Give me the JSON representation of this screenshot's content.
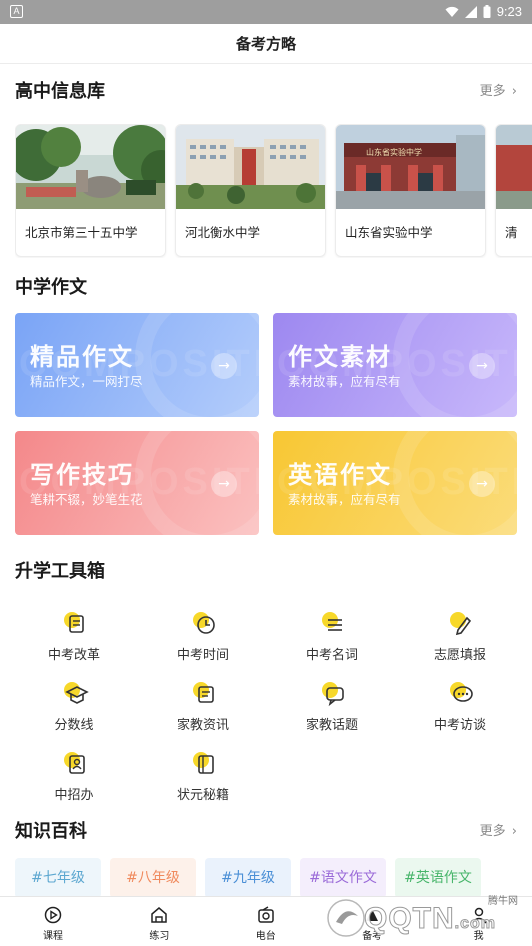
{
  "status_bar": {
    "time": "9:23"
  },
  "header": {
    "title": "备考方略"
  },
  "schools": {
    "title": "高中信息库",
    "more": "更多",
    "items": [
      {
        "name": "北京市第三十五中学"
      },
      {
        "name": "河北衡水中学"
      },
      {
        "name": "山东省实验中学",
        "sign_text": "山东省实验中学"
      },
      {
        "name": "清"
      }
    ]
  },
  "essays": {
    "title": "中学作文",
    "cards": [
      {
        "title": "精品作文",
        "subtitle": "精品作文，一网打尽",
        "bg_word": "COMPOSITION",
        "color_from": "#7aa4f6",
        "color_to": "#b4cdfb"
      },
      {
        "title": "作文素材",
        "subtitle": "素材故事，应有尽有",
        "bg_word": "COMPOSITION",
        "color_from": "#9d88f0",
        "color_to": "#c8b8fb"
      },
      {
        "title": "写作技巧",
        "subtitle": "笔耕不辍，妙笔生花",
        "bg_word": "COMPOSITION",
        "color_from": "#f4888a",
        "color_to": "#fbc1c0"
      },
      {
        "title": "英语作文",
        "subtitle": "素材故事，应有尽有",
        "bg_word": "COMPOSITION",
        "color_from": "#f8c733",
        "color_to": "#fbdc7a"
      }
    ]
  },
  "tools": {
    "title": "升学工具箱",
    "items": [
      {
        "label": "中考改革",
        "icon": "reform-doc-icon"
      },
      {
        "label": "中考时间",
        "icon": "clock-icon"
      },
      {
        "label": "中考名词",
        "icon": "list-icon"
      },
      {
        "label": "志愿填报",
        "icon": "pencil-icon"
      },
      {
        "label": "分数线",
        "icon": "graduation-cap-icon"
      },
      {
        "label": "家教资讯",
        "icon": "scroll-icon"
      },
      {
        "label": "家教话题",
        "icon": "chat-bubble-icon"
      },
      {
        "label": "中考访谈",
        "icon": "dialog-icon"
      },
      {
        "label": "中招办",
        "icon": "id-badge-icon"
      },
      {
        "label": "状元秘籍",
        "icon": "book-icon"
      }
    ]
  },
  "knowledge": {
    "title": "知识百科",
    "more": "更多",
    "tags": [
      {
        "label": "#七年级",
        "color": "#5ca7d0",
        "bg": "#eef6fb"
      },
      {
        "label": "#八年级",
        "color": "#f08a5d",
        "bg": "#fdf1ea"
      },
      {
        "label": "#九年级",
        "color": "#4a8fd6",
        "bg": "#eaf2fc"
      },
      {
        "label": "#语文作文",
        "color": "#9a6ad8",
        "bg": "#f4eefc"
      },
      {
        "label": "#英语作文",
        "color": "#47b56a",
        "bg": "#ebf8ef"
      }
    ]
  },
  "tabbar": {
    "items": [
      {
        "label": "课程",
        "icon": "play-circle-icon"
      },
      {
        "label": "练习",
        "icon": "practice-icon"
      },
      {
        "label": "电台",
        "icon": "radio-icon"
      },
      {
        "label": "备考",
        "icon": "prepare-icon"
      },
      {
        "label": "我",
        "icon": "profile-icon"
      }
    ]
  },
  "watermark": {
    "text_top": "腾牛网",
    "brand": "QQTN",
    "suffix": ".com"
  },
  "colors": {
    "accent_yellow": "#f7d82a",
    "tool_stroke": "#333333"
  }
}
